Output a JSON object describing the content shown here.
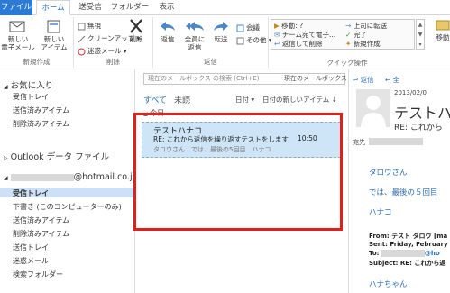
{
  "tabs": [
    "ファイル",
    "ホーム",
    "送受信",
    "フォルダー",
    "表示"
  ],
  "ribbon": {
    "new_email": "新しい\n電子メール",
    "new_items": "新しい\nアイテム",
    "new_group": "新規作成",
    "ignore": "無視",
    "cleanup": "クリーンアップ",
    "junk": "迷惑メール",
    "delete": "削除",
    "delete_group": "削除",
    "reply": "返信",
    "reply_all": "全員に\n返信",
    "forward": "転送",
    "meeting": "会議",
    "more": "その他",
    "respond_group": "返信",
    "quicksteps": [
      "移動: ?",
      "チーム宛て電子...",
      "返信して削除",
      "上司に転送",
      "完了",
      "新規作成"
    ],
    "quicksteps_group": "クイック操作",
    "move": "移動"
  },
  "nav": {
    "favorites": "お気に入り",
    "fav_items": [
      "受信トレイ",
      "送信済みアイテム",
      "削除済みアイテム"
    ],
    "outlook_file": "Outlook データ ファイル",
    "account": "@hotmail.co.jp",
    "folders": [
      "受信トレイ",
      "下書き (このコンピューターのみ)",
      "送信済みアイテム",
      "削除済みアイテム",
      "送信トレイ",
      "迷惑メール",
      "検索フォルダー"
    ]
  },
  "list": {
    "search_placeholder": "現在のメールボックス の検索 (Ctrl+E)",
    "search_scope": "現在のメールボックス",
    "filter_all": "すべて",
    "filter_unread": "未読",
    "sort_by": "日付",
    "sort_order": "日付の新しいアイテム",
    "today": "今日",
    "message": {
      "sender": "テストハナコ",
      "subject": "RE: これから返信を繰り返すテストをします",
      "time": "10:50",
      "preview": "タロウさん　では、最後の5回目　ハナコ"
    }
  },
  "reading": {
    "date": "2013/02/0",
    "sender": "テストハ",
    "subject": "RE: これから",
    "to_label": "宛先",
    "body": [
      "タロウさん",
      "では、最後の５回目",
      "ハナコ"
    ],
    "header_from": "From: テスト タロウ [ma",
    "header_sent": "Sent: Friday, February (",
    "header_to": "To:",
    "header_to_domain": "@ho",
    "header_subject": "Subject: RE: これから返",
    "body2": "ハナちゃん"
  },
  "colors": {
    "accent": "#2b7bd6",
    "highlight": "#cde5f7",
    "red": "#e0201b"
  }
}
